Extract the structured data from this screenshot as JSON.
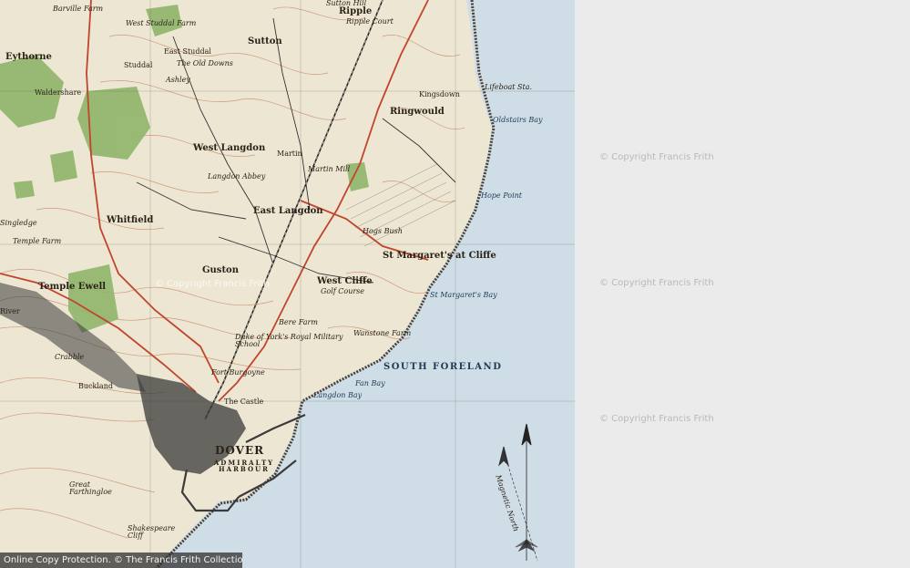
{
  "map": {
    "labels": {
      "sutton_hill": "Sutton Hill",
      "ripple": "Ripple",
      "ripple_court": "Ripple Court",
      "barville_farm": "Barville Farm",
      "west_studdal": "West Studdal Farm",
      "eythorne": "Eythorne",
      "studdal": "Studdal",
      "east_studdal": "East Studdal",
      "the_old_downs": "The Old Downs",
      "sutton": "Sutton",
      "waldershare": "Waldershare",
      "ashley": "Ashley",
      "ringwould": "Ringwould",
      "kingsdown": "Kingsdown",
      "lifeboat_sta": "Lifeboat Sta.",
      "oldstairs_bay": "Oldstairs Bay",
      "west_langdon": "West Langdon",
      "langdon_abbey": "Langdon Abbey",
      "martin": "Martin",
      "martin_mill": "Martin Mill",
      "hope_point": "Hope Point",
      "east_langdon": "East Langdon",
      "whitfield": "Whitfield",
      "singledge": "Singledge",
      "temple_farm": "Temple Farm",
      "hogs_bush": "Hogs Bush",
      "st_margarets_at_cliffe": "St Margaret's at Cliffe",
      "st_margarets_bay": "St Margaret's Bay",
      "guston": "Guston",
      "west_cliffe": "West Cliffe",
      "golf_course": "Golf Course",
      "temple_ewell": "Temple Ewell",
      "river": "River",
      "bere_farm": "Bere Farm",
      "dukeofyorks": "Duke of York's Royal Military School",
      "wanstone_farm": "Wanstone Farm",
      "south_foreland": "SOUTH FORELAND",
      "fan_bay": "Fan Bay",
      "langdon_bay": "Langdon Bay",
      "fort_burgoyne": "Fort Burgoyne",
      "buckland": "Buckland",
      "the_castle": "The Castle",
      "dover": "DOVER",
      "admiralty_harbour": "ADMIRALTY HARBOUR",
      "shakespeare_cliff": "Shakespeare Cliff",
      "great_farthingloe": "Great Farthingloe",
      "crabble": "Crabble",
      "magnetic_north": "Magnetic North"
    },
    "in_map_watermark": "© Copyright Francis Frith"
  },
  "watermarks": [
    "© Copyright Francis Frith",
    "© Copyright Francis Frith",
    "© Copyright Francis Frith"
  ],
  "footer": {
    "text": "Online Copy Protection. © The Francis Frith Collection"
  },
  "colors": {
    "land": "#ede6d2",
    "sea": "#cfdde6",
    "contour": "#c9866a",
    "woodland": "#8fb56a",
    "road": "#c0452c",
    "urban": "#3a3a3a"
  }
}
